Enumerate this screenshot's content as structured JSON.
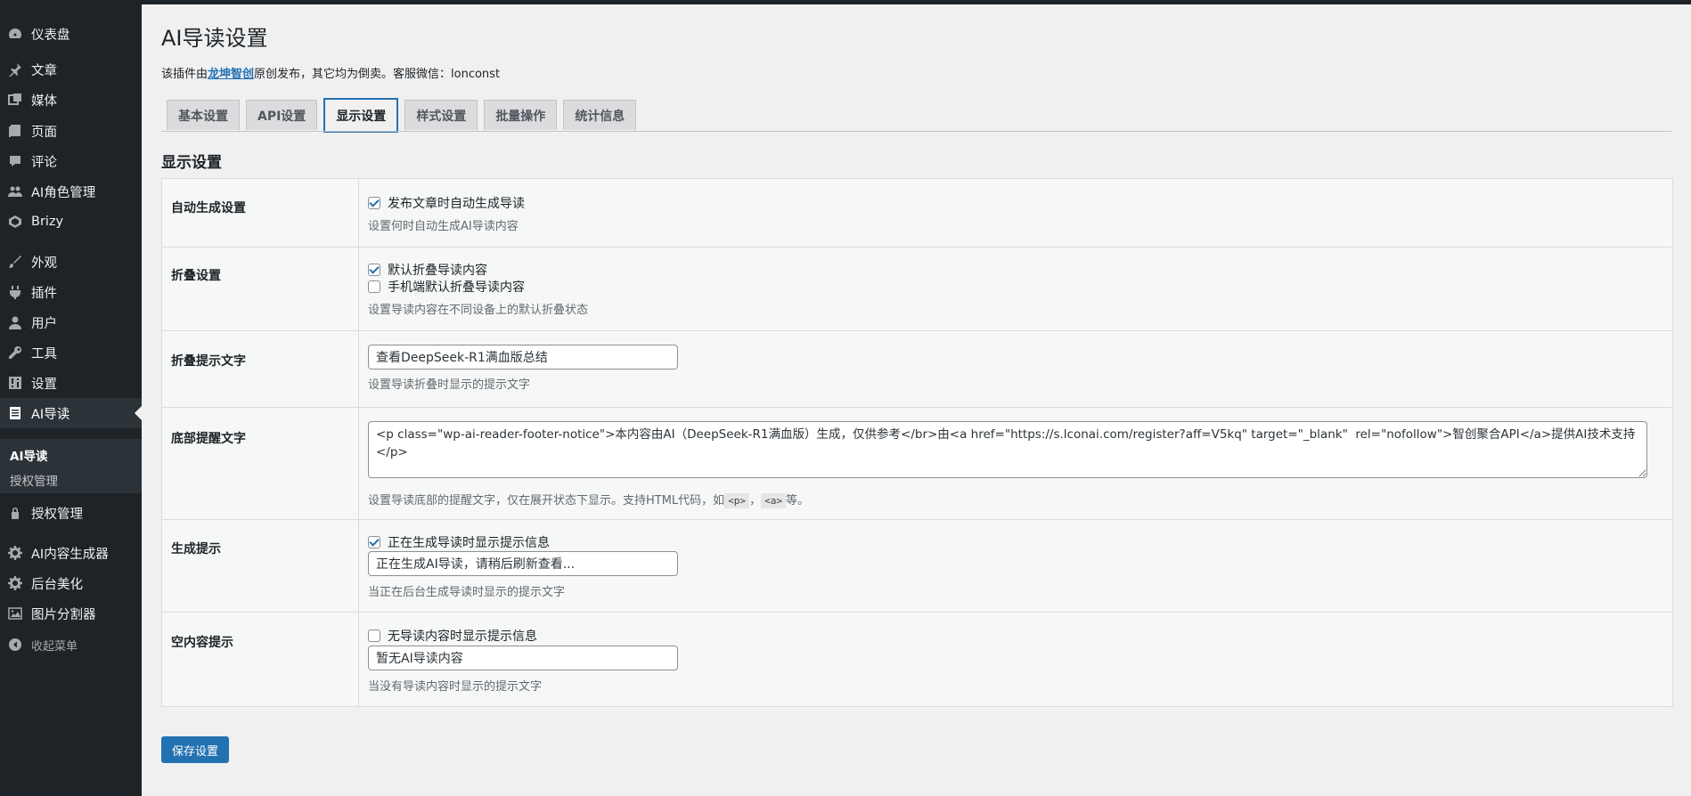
{
  "sidebar": {
    "items": [
      {
        "label": "仪表盘",
        "icon": "dashboard-icon"
      },
      {
        "label": "文章",
        "icon": "pin-icon"
      },
      {
        "label": "媒体",
        "icon": "media-icon"
      },
      {
        "label": "页面",
        "icon": "page-icon"
      },
      {
        "label": "评论",
        "icon": "comment-icon"
      },
      {
        "label": "AI角色管理",
        "icon": "users-group-icon"
      },
      {
        "label": "Brizy",
        "icon": "brizy-icon"
      },
      {
        "label": "外观",
        "icon": "brush-icon"
      },
      {
        "label": "插件",
        "icon": "plugin-icon"
      },
      {
        "label": "用户",
        "icon": "user-icon"
      },
      {
        "label": "工具",
        "icon": "wrench-icon"
      },
      {
        "label": "设置",
        "icon": "settings-icon"
      },
      {
        "label": "AI导读",
        "icon": "document-icon"
      },
      {
        "label": "授权管理",
        "icon": "lock-icon"
      },
      {
        "label": "AI内容生成器",
        "icon": "gear-icon"
      },
      {
        "label": "后台美化",
        "icon": "gear-icon"
      },
      {
        "label": "图片分割器",
        "icon": "image-icon"
      },
      {
        "label": "收起菜单",
        "icon": "collapse-icon"
      }
    ],
    "submenu": [
      "AI导读",
      "授权管理"
    ]
  },
  "page": {
    "title": "AI导读设置",
    "intro_prefix": "该插件由",
    "intro_link": "龙坤智创",
    "intro_suffix": "原创发布，其它均为倒卖。客服微信：lonconst"
  },
  "tabs": [
    "基本设置",
    "API设置",
    "显示设置",
    "样式设置",
    "批量操作",
    "统计信息"
  ],
  "section_title": "显示设置",
  "form": {
    "auto": {
      "label": "自动生成设置",
      "checkbox": "发布文章时自动生成导读",
      "checked": true,
      "desc": "设置何时自动生成AI导读内容"
    },
    "fold": {
      "label": "折叠设置",
      "checkbox1": "默认折叠导读内容",
      "checked1": true,
      "checkbox2": "手机端默认折叠导读内容",
      "checked2": false,
      "desc": "设置导读内容在不同设备上的默认折叠状态"
    },
    "fold_text": {
      "label": "折叠提示文字",
      "value": "查看DeepSeek-R1满血版总结",
      "desc": "设置导读折叠时显示的提示文字"
    },
    "footer_text": {
      "label": "底部提醒文字",
      "value": "<p class=\"wp-ai-reader-footer-notice\">本内容由AI（DeepSeek-R1满血版）生成，仅供参考</br>由<a href=\"https://s.lconai.com/register?aff=V5kq\" target=\"_blank\"  rel=\"nofollow\">智创聚合API</a>提供AI技术支持</p>",
      "desc_prefix": "设置导读底部的提醒文字，仅在展开状态下显示。支持HTML代码，如",
      "code1": "<p>",
      "sep": "，",
      "code2": "<a>",
      "desc_suffix": "等。"
    },
    "generating": {
      "label": "生成提示",
      "checkbox": "正在生成导读时显示提示信息",
      "checked": true,
      "value": "正在生成AI导读，请稍后刷新查看...",
      "desc": "当正在后台生成导读时显示的提示文字"
    },
    "empty": {
      "label": "空内容提示",
      "checkbox": "无导读内容时显示提示信息",
      "checked": false,
      "value": "暂无AI导读内容",
      "desc": "当没有导读内容时显示的提示文字"
    }
  },
  "save_button": "保存设置"
}
